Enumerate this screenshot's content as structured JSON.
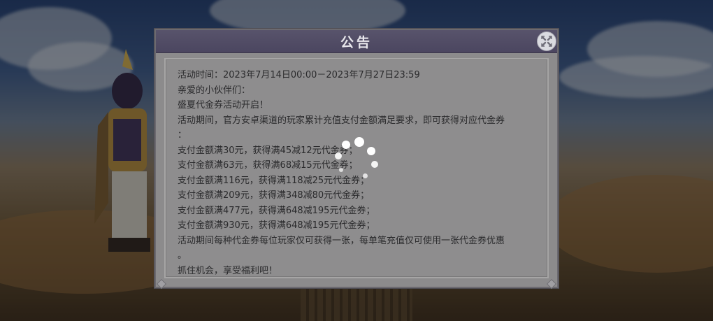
{
  "dialog": {
    "title": "公告",
    "lines": [
      "活动时间：2023年7月14日00:00－2023年7月27日23:59",
      "亲爱的小伙伴们：",
      "盛夏代金券活动开启！",
      "活动期间，官方安卓渠道的玩家累计充值支付金额满足要求，即可获得对应代金券",
      "：",
      "支付金额满30元，获得满45减12元代金券；",
      "支付金额满63元，获得满68减15元代金券；",
      "支付金额满116元，获得满118减25元代金券；",
      "支付金额满209元，获得满348减80元代金券；",
      "支付金额满477元，获得满648减195元代金券；",
      "支付金额满930元，获得满648减195元代金券；",
      "活动期间每种代金券每位玩家仅可获得一张，每单笔充值仅可使用一张代金券优惠",
      "。",
      "抓住机会，享受福利吧！"
    ]
  },
  "icons": {
    "close": "close-x-icon",
    "loading": "loading-spinner-icon"
  },
  "colors": {
    "header": "#4b4660",
    "panel": "#8c8b8c",
    "text": "#2a2a2c"
  }
}
